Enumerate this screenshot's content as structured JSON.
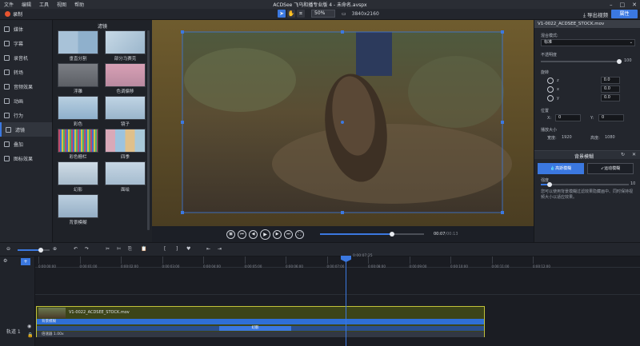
{
  "menu": [
    "文件",
    "编辑",
    "工具",
    "视图",
    "帮助"
  ],
  "window_title": "ACDSee 飞乌和播专业版 4 - 未命名.avspx",
  "toolbar": {
    "record_label": "录制",
    "zoom_value": "50%",
    "resolution": "3840x2160",
    "export_label": "导出视频",
    "properties_label": "属性"
  },
  "sidebar": {
    "items": [
      "媒体",
      "字幕",
      "录音机",
      "转场",
      "音频效果",
      "动画",
      "行为",
      "滤镜",
      "叠加",
      "图标效果"
    ],
    "selected": 7
  },
  "filters": {
    "title": "滤镜",
    "items": [
      {
        "label": "垂直分割",
        "icon": "lake-icon"
      },
      {
        "label": "部分马赛克",
        "icon": "lake-icon"
      },
      {
        "label": "浮雕",
        "icon": "lake-icon"
      },
      {
        "label": "色调偏移",
        "icon": "lake-icon"
      },
      {
        "label": "彩色",
        "icon": "lake-icon"
      },
      {
        "label": "镜子",
        "icon": "lake-icon"
      },
      {
        "label": "彩色栅栏",
        "icon": "lake-icon"
      },
      {
        "label": "四季",
        "icon": "lake-icon"
      },
      {
        "label": "幻影",
        "icon": "lake-icon"
      },
      {
        "label": "面绘",
        "icon": "lake-icon"
      },
      {
        "label": "背景模糊",
        "icon": "lake-icon"
      }
    ]
  },
  "playback": {
    "current_time": "00:07",
    "total_time": "00:13",
    "progress": 0.69
  },
  "right_panel": {
    "clip_name": "V1-0022_ACDSEE_STOCK.mov",
    "blend_label": "混合模式:",
    "blend_value": "标准",
    "opacity_label": "不透明度",
    "opacity_value": "100",
    "rotate_label": "旋转",
    "rotation_values": [
      "0.0",
      "0.0",
      "0.0"
    ],
    "position_label": "位置",
    "pos_x_label": "X:",
    "pos_x": "0",
    "pos_y_label": "Y:",
    "pos_y": "0",
    "size_label": "播放大小",
    "width_label": "宽度:",
    "width_value": "1920",
    "height_label": "高度:",
    "height_value": "1080",
    "bg_blur_title": "背景模糊",
    "blur_btn1": "高斯模糊",
    "blur_btn2": "运动模糊",
    "strength_label": "强度",
    "strength_value": "10",
    "strength_fraction": 0.1,
    "description": "您可以使用背景模糊过滤效果隐藏画中、同时保持视频大小以适应效果。"
  },
  "timeline": {
    "playhead_time": "0:00:07;25",
    "ticks": [
      "0:00:00;00",
      "0:00:01;00",
      "0:00:02;00",
      "0:00:03;00",
      "0:00:04;00",
      "0:00:05;00",
      "0:00:06;00",
      "0:00:07;00",
      "0:00:08;00",
      "0:00:09;00",
      "0:00:10;00",
      "0:00:11;00",
      "0:00:12;00"
    ],
    "track_label": "轨道 1",
    "clip_name": "V1-0022_ACDSEE_STOCK.mov",
    "effect_bar": "背景模糊",
    "fx_label": "幻影",
    "speed_label": "倍速器 1.00x"
  }
}
